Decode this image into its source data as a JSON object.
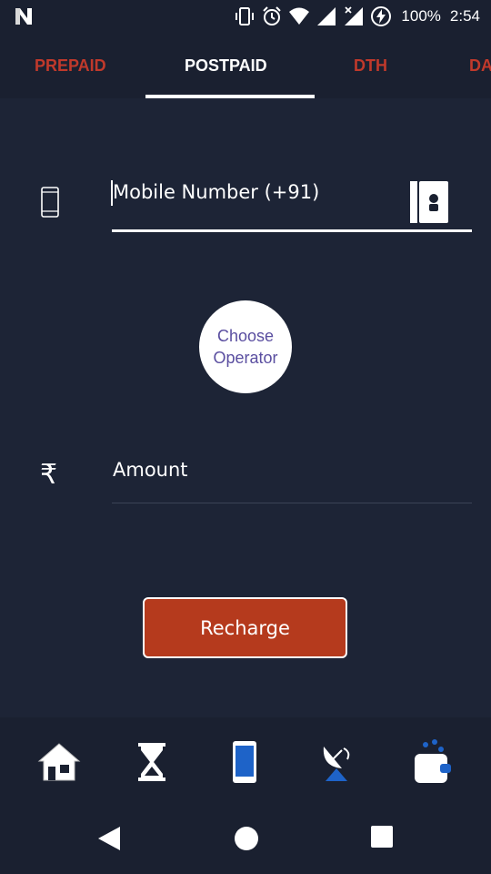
{
  "status_bar": {
    "battery_percent": "100%",
    "time": "2:54",
    "icons": [
      "n-logo-icon",
      "vibrate-icon",
      "alarm-icon",
      "wifi-icon",
      "signal-icon",
      "signal-no-data-icon",
      "battery-charging-icon"
    ]
  },
  "tabs": [
    {
      "label": "PREPAID",
      "active": false
    },
    {
      "label": "POSTPAID",
      "active": true
    },
    {
      "label": "DTH",
      "active": false
    },
    {
      "label": "DA",
      "active": false
    }
  ],
  "form": {
    "mobile_placeholder": "Mobile Number (+91)",
    "operator_label_line1": "Choose",
    "operator_label_line2": "Operator",
    "amount_placeholder": "Amount",
    "rupee_symbol": "₹",
    "recharge_label": "Recharge"
  },
  "bottom_nav": {
    "items": [
      "home-icon",
      "hourglass-icon",
      "mobile-icon",
      "satellite-dish-icon",
      "wallet-icon"
    ]
  },
  "colors": {
    "background": "#1a2030",
    "accent_red": "#c0392b",
    "button_red": "#b53a1d",
    "operator_text": "#5a4ea0",
    "nav_blue": "#1e63c8"
  }
}
